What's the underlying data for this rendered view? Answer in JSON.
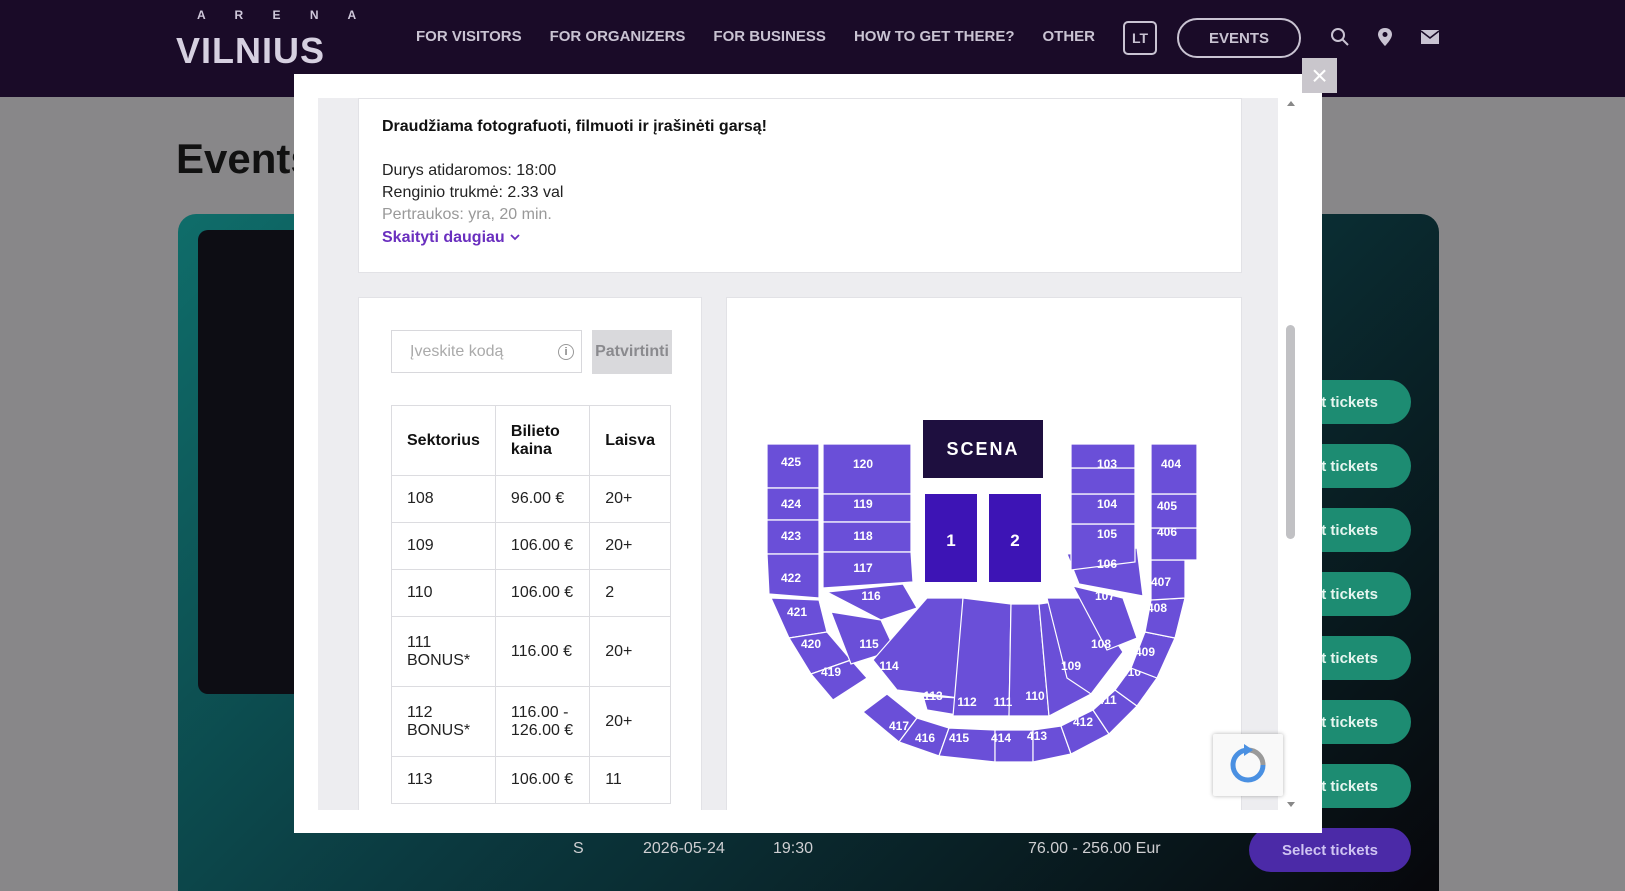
{
  "header": {
    "logo_small": "A R E N A",
    "logo_big": "VILNIUS",
    "nav": [
      "FOR VISITORS",
      "FOR ORGANIZERS",
      "FOR BUSINESS",
      "HOW TO GET THERE?",
      "OTHER"
    ],
    "lang": "LT",
    "events_label": "EVENTS"
  },
  "page": {
    "title": "Events",
    "select_label": "Select tickets",
    "last_row": {
      "day": "S",
      "date": "2026-05-24",
      "time": "19:30",
      "price": "76.00 - 256.00 Eur"
    }
  },
  "modal": {
    "close": "×",
    "description": {
      "warning": "Draudžiama fotografuoti, filmuoti ir įrašinėti garsą!",
      "doors": "Durys atidaromos: 18:00",
      "duration": "Renginio trukmė: 2.33 val",
      "breaks": "Pertraukos: yra, 20 min.",
      "read_more": "Skaityti daugiau"
    },
    "promo": {
      "placeholder": "Įveskite kodą",
      "confirm": "Patvirtinti"
    },
    "table": {
      "headers": [
        "Sektorius",
        "Bilieto kaina",
        "Laisva"
      ],
      "rows": [
        [
          "108",
          "96.00 €",
          "20+"
        ],
        [
          "109",
          "106.00 €",
          "20+"
        ],
        [
          "110",
          "106.00 €",
          "2"
        ],
        [
          "111 BONUS*",
          "116.00 €",
          "20+"
        ],
        [
          "112 BONUS*",
          "116.00 - 126.00 €",
          "20+"
        ],
        [
          "113",
          "106.00 €",
          "11"
        ]
      ]
    },
    "map": {
      "stage": "SCENA",
      "floor": [
        "1",
        "2"
      ],
      "sectors": [
        "425",
        "424",
        "423",
        "422",
        "421",
        "420",
        "419",
        "417",
        "416",
        "415",
        "414",
        "413",
        "412",
        "411",
        "410",
        "409",
        "408",
        "407",
        "406",
        "405",
        "404",
        "120",
        "119",
        "118",
        "117",
        "116",
        "115",
        "114",
        "113",
        "112",
        "111",
        "110",
        "109",
        "108",
        "107",
        "106",
        "105",
        "104",
        "103"
      ],
      "sector_color": "#6a4fd8",
      "stage_color": "#1e0f3f",
      "floor_color": "#3d14b5"
    }
  }
}
